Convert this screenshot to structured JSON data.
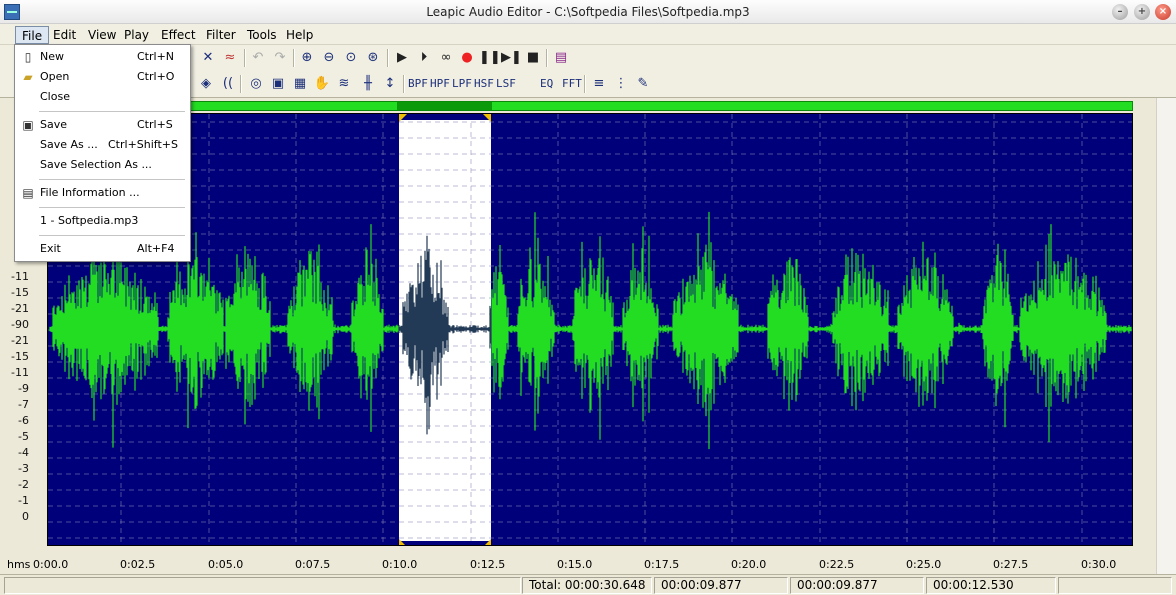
{
  "window": {
    "title": "Leapic Audio Editor - C:\\Softpedia Files\\Softpedia.mp3",
    "minimize": "–",
    "maximize": "+",
    "close": "×"
  },
  "menubar": [
    "File",
    "Edit",
    "View",
    "Play",
    "Effect",
    "Filter",
    "Tools",
    "Help"
  ],
  "toolbar1": {
    "icons": [
      "cut-icon",
      "waveform-edit-icon",
      "undo-icon",
      "redo-icon",
      "zoom-in-icon",
      "zoom-out-icon",
      "zoom-selection-icon",
      "zoom-fit-icon",
      "play-icon",
      "play-selection-icon",
      "loop-icon",
      "record-icon",
      "pause-icon",
      "step-icon",
      "stop-icon",
      "book-icon"
    ]
  },
  "toolbar2": {
    "filters": [
      "BPF",
      "HPF",
      "LPF",
      "HSF",
      "LSF",
      "EQ",
      "FFT"
    ]
  },
  "file_menu": {
    "items": [
      {
        "label": "New",
        "shortcut": "Ctrl+N",
        "icon": "new-file-icon"
      },
      {
        "label": "Open",
        "shortcut": "Ctrl+O",
        "icon": "open-folder-icon"
      },
      {
        "label": "Close",
        "shortcut": "",
        "icon": ""
      },
      {
        "label": "Save",
        "shortcut": "Ctrl+S",
        "icon": "save-disk-icon"
      },
      {
        "label": "Save As ...",
        "shortcut": "Ctrl+Shift+S",
        "icon": ""
      },
      {
        "label": "Save Selection As ...",
        "shortcut": "",
        "icon": ""
      },
      {
        "label": "File Information ...",
        "shortcut": "",
        "icon": "file-info-icon"
      },
      {
        "label": "1 - Softpedia.mp3",
        "shortcut": "",
        "icon": ""
      },
      {
        "label": "Exit",
        "shortcut": "Alt+F4",
        "icon": ""
      }
    ]
  },
  "db_scale": [
    "-11",
    "-15",
    "-21",
    "-90",
    "-21",
    "-15",
    "-11",
    "-9",
    "-7",
    "-6",
    "-5",
    "-4",
    "-3",
    "-2",
    "-1",
    "0"
  ],
  "time_ruler": {
    "unit": "hms",
    "labels": [
      "0:00.0",
      "0:02.5",
      "0:05.0",
      "0:07.5",
      "0:10.0",
      "0:12.5",
      "0:15.0",
      "0:17.5",
      "0:20.0",
      "0:22.5",
      "0:25.0",
      "0:27.5",
      "0:30.0"
    ]
  },
  "selection": {
    "start": "00:00:09.877",
    "end": "00:00:12.530"
  },
  "status": {
    "total": "Total: 00:00:30.648",
    "cursor": "00:00:09.877",
    "sel_start": "00:00:09.877",
    "sel_end": "00:00:12.530"
  },
  "colors": {
    "wave_bg": "#00007a",
    "wave": "#22dd22",
    "selected_wave": "#223a55",
    "selection_bg": "#ffffff"
  }
}
